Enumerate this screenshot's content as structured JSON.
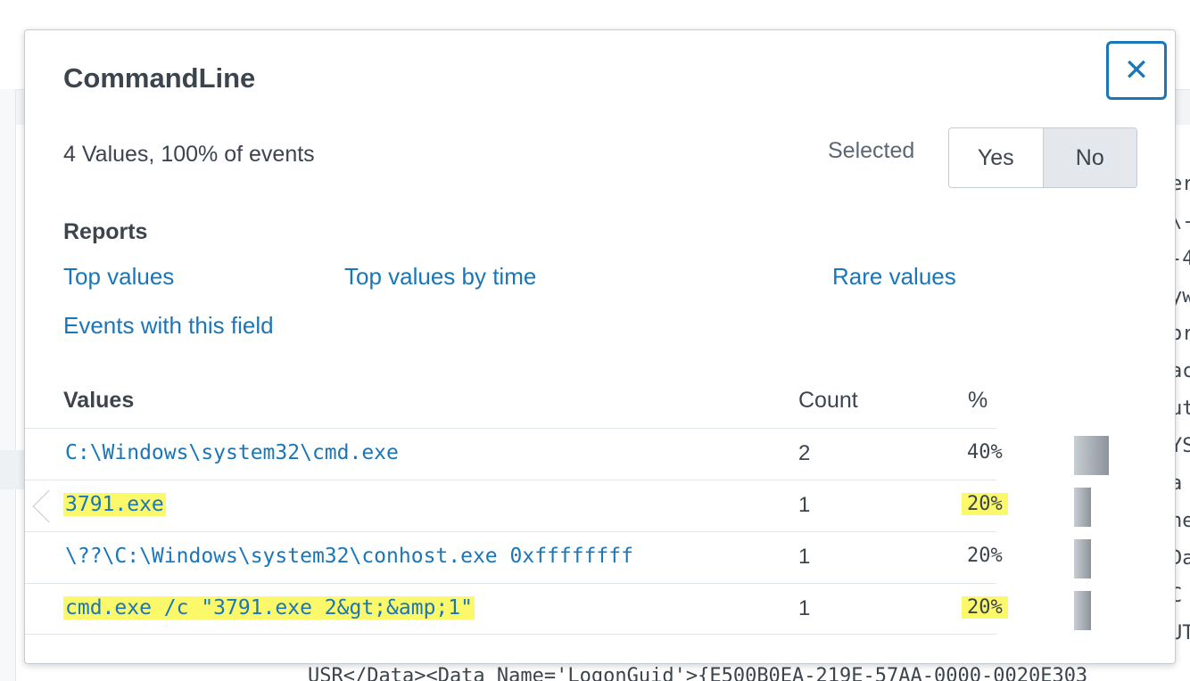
{
  "background": {
    "right_fragments": [
      "er",
      "\\-",
      "-4",
      "yw",
      "or",
      "ac",
      "ut",
      "YS",
      "a",
      "ne",
      "Da",
      "C",
      "UT"
    ],
    "bottom_text": "USR</Data><Data Name='LogonGuid'>{E500B0EA-219E-57AA-0000-0020E303"
  },
  "popover": {
    "title": "CommandLine",
    "close_label": "✕",
    "summary": "4 Values, 100% of events",
    "selected_label": "Selected",
    "toggle": {
      "yes": "Yes",
      "no": "No",
      "active": "No"
    },
    "reports": {
      "heading": "Reports",
      "top_values": "Top values",
      "top_values_by_time": "Top values by time",
      "rare_values": "Rare values",
      "events_with_field": "Events with this field"
    },
    "table": {
      "headers": {
        "values": "Values",
        "count": "Count",
        "percent": "%"
      },
      "rows": [
        {
          "value": "C:\\Windows\\system32\\cmd.exe",
          "count": "2",
          "percent": "40%",
          "fraction": 0.4,
          "value_highlight": false,
          "pct_highlight": false
        },
        {
          "value": "3791.exe",
          "count": "1",
          "percent": "20%",
          "fraction": 0.2,
          "value_highlight": true,
          "pct_highlight": true
        },
        {
          "value": "\\??\\C:\\Windows\\system32\\conhost.exe 0xffffffff",
          "count": "1",
          "percent": "20%",
          "fraction": 0.2,
          "value_highlight": false,
          "pct_highlight": false
        },
        {
          "value": "cmd.exe /c \"3791.exe 2&gt;&amp;1\"",
          "count": "1",
          "percent": "20%",
          "fraction": 0.2,
          "value_highlight": true,
          "pct_highlight": true
        }
      ]
    },
    "highlight_color": "#fbf96a",
    "link_color": "#1a76b8"
  }
}
